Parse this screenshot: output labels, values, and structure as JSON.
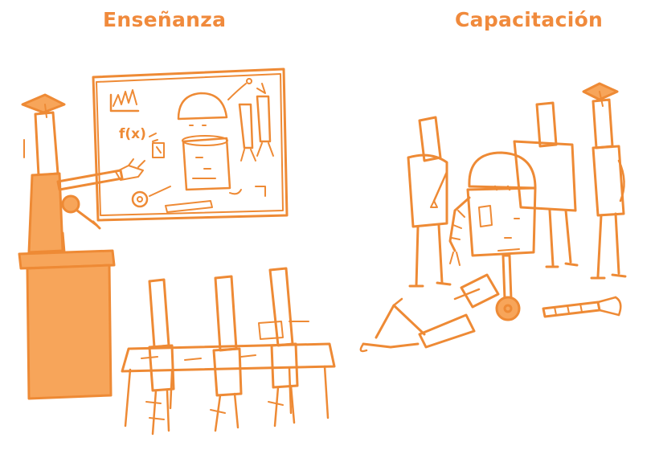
{
  "titles": {
    "left": "Enseñanza",
    "right": "Capacitación"
  },
  "colors": {
    "stroke": "#ee8a35",
    "fill": "#f7a55a",
    "title": "#f08a3c",
    "background": "#ffffff"
  },
  "board": {
    "formula": "f(x)"
  }
}
